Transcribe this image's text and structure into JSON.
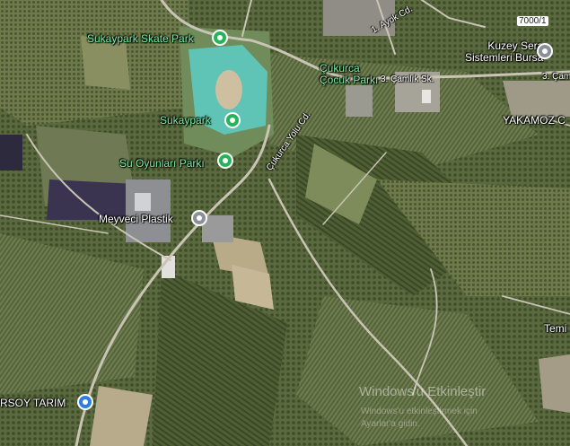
{
  "places": {
    "skate_park": "Sukaypark Skate Park",
    "cukurca_park": "Çukurca\nÇocuk Parkı",
    "sukaypark": "Sukaypark",
    "su_oyunlari": "Su Oyunları Parkı",
    "meyveci": "Meyveci Plastik",
    "kuzey_sera": "Kuzey Sera\nSistemleri Bursa",
    "yakamoz": "YAKAMOZ C",
    "ersoy": "RSOY TARIM",
    "temi": "Temi"
  },
  "roads": {
    "ayok": "1. Ayok Cd.",
    "camlik": "3. Çamlık Sk.",
    "camlik_right": "3. Çam",
    "cukurca_yolu": "Çukurca Yolu Cd."
  },
  "plus_code": "7000/1",
  "watermark": {
    "title": "Windows'u Etkinleştir",
    "subtitle": "Windows'u etkinleştirmek için",
    "subtitle2": "Ayarlar'a gidin."
  },
  "icons": {
    "park": "park-pin-icon",
    "business": "business-pin-icon",
    "shop": "shop-pin-icon"
  },
  "colors": {
    "park_label": "#7df0a2",
    "park_pin": "#27b35a",
    "business_pin": "#8a9096",
    "shop_pin": "#2f7de0",
    "pool": "#5fc3b5"
  }
}
